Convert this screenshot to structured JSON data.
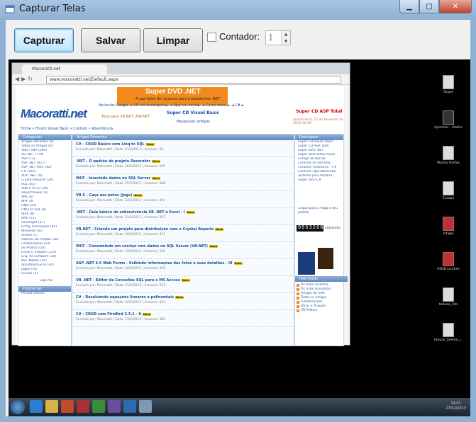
{
  "window": {
    "title": "Capturar Telas"
  },
  "toolbar": {
    "capture_label": "Capturar",
    "save_label": "Salvar",
    "clear_label": "Limpar",
    "counter_label": "Contador:",
    "counter_value": "1",
    "counter_checked": false
  },
  "capture": {
    "browser": {
      "tab_title": "Macoratti.net",
      "url": "www.macoratti.net/Default.aspx",
      "banner_title": "Super DVD .NET",
      "banner_sub": "A sua fonte de recursos para a plataforma .NET",
      "logo": "Macoratti.net",
      "logo_sub": "Tudo para VB.NET, ASP.NET",
      "mid_links": "Anúncios Google   ◄ VB net developers►   ◄ App net excel►   ◄ Curso excel ►   ◄ C# ►",
      "mid_link2": "Super CD Visual Basic",
      "search": "Pesquisar artigos",
      "promo_right": "Super CD ASP Total",
      "date": "quarta-feira, 27 de fevereiro de 2013 10:59",
      "breadcrumbs": "Home • Fórum Visual Basic • Contato • Advertência",
      "left_head": "Categorias",
      "left_items": [
        "Artigos Recentes (6)",
        "Todos os Artigos (6)",
        "VB6 / VBA (394)",
        "VB .NET (774)",
        "ASP (73)",
        "ASP .NET (417)",
        "ASP .NET MVC (42)",
        "C# (145)",
        "ADO .NET (8)",
        "Crystal Reports (20)",
        "SQL (33)",
        "VBA e VSTO (30)",
        "ReportViewer (1)",
        "XML (6)",
        "WPF (4)",
        "LINQ (41)",
        "LINQ To SQL (6)",
        "AJAX (8)",
        "MVP (75)",
        "Silverlight (47)",
        "Entity Framework (62)",
        "Windows (42)",
        "Vídeos (2)",
        "Padrões de Projeto (28)",
        "Colaborações (14)",
        "VB Prático (20)",
        "Dicas e Truques (213)",
        "Eng. de Software (38)",
        "NET Mobile (10)",
        "Apostilas/Livros (40)",
        "Jogos (16)",
        "Cursos (3)"
      ],
      "left_sub": "Siga-me",
      "left_head2": "Programas",
      "left_item2": "Pessoa Infantil",
      "center_head": "Artigos Recentes",
      "articles": [
        {
          "title": "C# - CRUD Básico com Linq to SQL",
          "meta": "Enviado por: Macoratti | Data: 27/2/2013 | Acessos: 58"
        },
        {
          "title": ".NET - O padrão de projeto Decorator",
          "meta": "Enviado por: Macoratti | Data: 26/2/2013 | Acessos: 285"
        },
        {
          "title": "WCF - Inserindo dados no SQL Server",
          "meta": "Enviado por: Macoratti | Data: 25/2/2013 | Acessos: 388"
        },
        {
          "title": "VB 6 - Caça aos patos (Jogo)",
          "meta": "Enviado por: Macoratti | Data: 22/2/2013 | Acessos: 394"
        },
        {
          "title": ".NET - Guia básico de sobrevivência VB .NET e Excel - I",
          "meta": "Enviado por: Macoratti | Data: 21/2/2013 | Acessos: 457"
        },
        {
          "title": "VB.NET - Criando um projeto para distribuição com o Crystal Reports",
          "meta": "Enviado por: Macoratti | Data: 20/2/2013 | Acessos: 421"
        },
        {
          "title": "WCF - Consumindo um serviço com dados no SQL Server (VB.NET)",
          "meta": "Enviado por: Macoratti | Data: 19/2/2013 | Acessos: 330"
        },
        {
          "title": "ASP .NET 4.5 Web Forms - Exibindo informações das fotos e suas detalhes - III",
          "meta": "Enviado por: Macoratti | Data: 18/2/2013 | Acessos: 509"
        },
        {
          "title": "VB .NET - Editor de Consultas SQL para o MS Access",
          "meta": "Enviado por: Macoratti | Data: 15/2/2013 | Acessos: 523"
        },
        {
          "title": "C# - Resolvendo equações lineares e polinomiais",
          "meta": "Enviado por: Macoratti | Data: 14/2/2013 | Acessos: 463"
        },
        {
          "title": "C# - CRUD com FireBird 2.5.1 - II",
          "meta": "Enviado por: Macoratti | Data: 13/2/2013 | Acessos: 485"
        }
      ],
      "new_badge": "Novo",
      "right_head": "Destaques",
      "right_items": [
        "Super CD Visual Basic",
        "Super CD ASP Total",
        "Super DVD .NET",
        "Super DVD Vídeo Aulas",
        "Código de Barras",
        "Controle de Parcelas",
        "Controle Financeiro - C#",
        "Controle Agendamentos",
        "Sistema para Pizzaria",
        "Super DVD C#"
      ],
      "right_promo": "Clique para a Paga o seu pedido",
      "counter": "8953268",
      "counter_label": "visitantes",
      "rss_head": "RSS Feeds",
      "rss_items": [
        "Os mais recentes",
        "Os mais acessados",
        "Artigos do mês",
        "Todos os artigos",
        "Colaborações",
        "Dicas e Truques",
        "VB Prático"
      ]
    },
    "desktop_icons": [
      {
        "label": "Skype",
        "icon": "skype-icon"
      },
      {
        "label": "tipcenter - Atalho",
        "icon": "shortcut-icon"
      },
      {
        "label": "Mozilla Firefox",
        "icon": "firefox-icon"
      },
      {
        "label": "Europa",
        "icon": "folder-icon"
      },
      {
        "label": "artigos",
        "icon": "document-icon"
      },
      {
        "label": "ASOB Londres",
        "icon": "pdf-icon"
      },
      {
        "label": "tabuas_info",
        "icon": "document-icon"
      },
      {
        "label": "tabuas_tablem_i...",
        "icon": "document-icon"
      }
    ],
    "taskbar": {
      "time": "10:01",
      "date": "27/02/2013"
    }
  }
}
